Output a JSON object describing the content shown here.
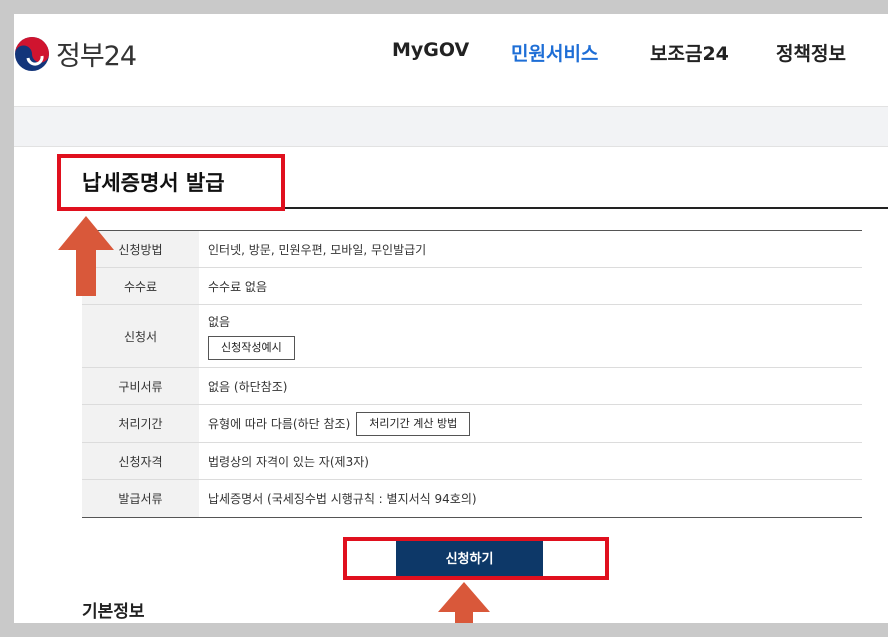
{
  "header": {
    "logo_text": "정부24",
    "nav": [
      "MyGOV",
      "민원서비스",
      "보조금24",
      "정책정보"
    ],
    "active_nav": "민원서비스"
  },
  "page": {
    "title": "납세증명서 발급"
  },
  "info_table": {
    "rows": [
      {
        "label": "신청방법",
        "value": "인터넷, 방문, 민원우편, 모바일, 무인발급기"
      },
      {
        "label": "수수료",
        "value": "수수료 없음"
      },
      {
        "label": "신청서",
        "value": "없음",
        "button": "신청작성예시"
      },
      {
        "label": "구비서류",
        "value": "없음 (하단참조)"
      },
      {
        "label": "처리기간",
        "value": "유형에 따라 다름(하단 참조)",
        "button": "처리기간 계산 방법"
      },
      {
        "label": "신청자격",
        "value": "법령상의 자격이 있는 자(제3자)"
      },
      {
        "label": "발급서류",
        "value": "납세증명서 (국세징수법 시행규칙 : 별지서식 94호의)"
      }
    ]
  },
  "apply_button": "신청하기",
  "section": {
    "title": "기본정보"
  },
  "colors": {
    "highlight": "#e0101e",
    "arrow": "#d9583a",
    "apply_button_bg": "#0d3868",
    "active_nav": "#1e6ed6"
  },
  "icons": {
    "logo": "taegeuk-logo-icon",
    "annotation": "arrow-up-icon"
  }
}
